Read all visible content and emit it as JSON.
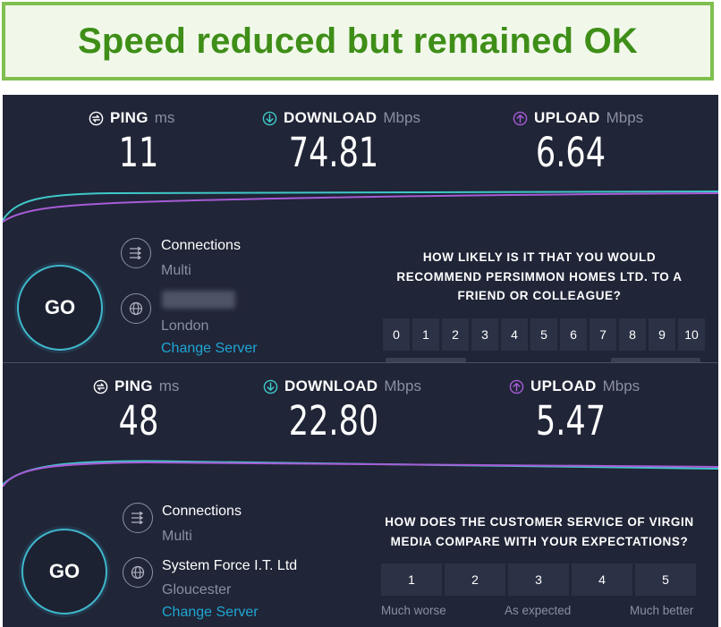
{
  "banner": {
    "text": "Speed reduced but remained OK"
  },
  "colors": {
    "banner_green": "#3e8e18",
    "panel_bg": "#202537",
    "download_accent": "#3fc8c8",
    "upload_accent": "#a65cd6",
    "link": "#1fa6d3"
  },
  "icons": {
    "ping": "ping-icon",
    "download": "download-arrow-icon",
    "upload": "upload-arrow-icon",
    "connections": "connections-arrows-icon",
    "server": "globe-icon"
  },
  "test1": {
    "ping": {
      "label": "PING",
      "unit": "ms",
      "value": "11"
    },
    "download": {
      "label": "DOWNLOAD",
      "unit": "Mbps",
      "value": "74.81"
    },
    "upload": {
      "label": "UPLOAD",
      "unit": "Mbps",
      "value": "6.64"
    },
    "go_label": "GO",
    "connections_label": "Connections",
    "connections_value": "Multi",
    "server_location": "London",
    "change_server": "Change Server",
    "survey_question_lines": [
      "HOW LIKELY IS IT THAT YOU WOULD",
      "RECOMMEND PERSIMMON HOMES LTD. TO A",
      "FRIEND OR COLLEAGUE?"
    ],
    "scale": [
      "0",
      "1",
      "2",
      "3",
      "4",
      "5",
      "6",
      "7",
      "8",
      "9",
      "10"
    ]
  },
  "test2": {
    "ping": {
      "label": "PING",
      "unit": "ms",
      "value": "48"
    },
    "download": {
      "label": "DOWNLOAD",
      "unit": "Mbps",
      "value": "22.80"
    },
    "upload": {
      "label": "UPLOAD",
      "unit": "Mbps",
      "value": "5.47"
    },
    "go_label": "GO",
    "connections_label": "Connections",
    "connections_value": "Multi",
    "server_name": "System Force I.T. Ltd",
    "server_location": "Gloucester",
    "change_server": "Change Server",
    "survey_question_lines": [
      "HOW DOES THE CUSTOMER SERVICE OF VIRGIN",
      "MEDIA COMPARE WITH YOUR EXPECTATIONS?"
    ],
    "scale": [
      "1",
      "2",
      "3",
      "4",
      "5"
    ],
    "scale_captions": {
      "low": "Much worse",
      "mid": "As expected",
      "high": "Much better"
    }
  }
}
